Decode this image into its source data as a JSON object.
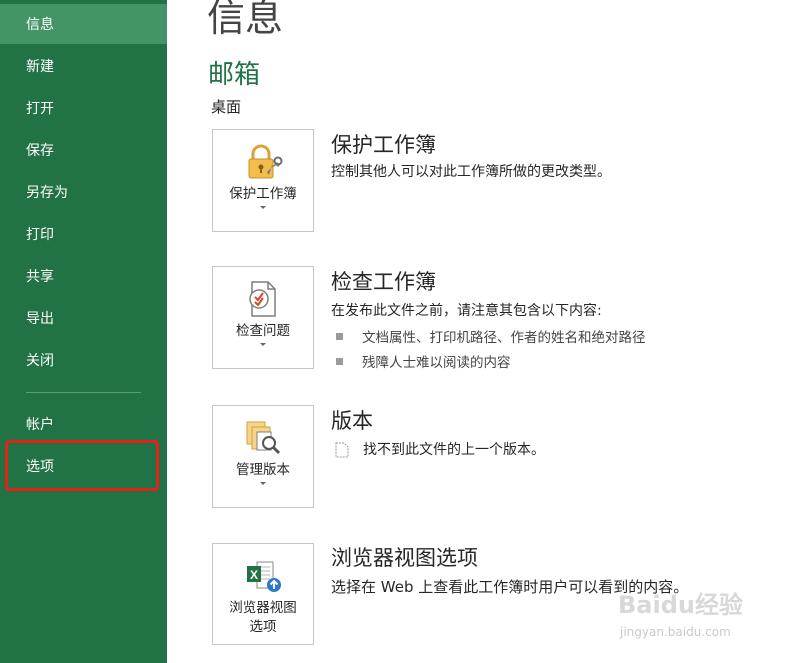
{
  "sidebar": {
    "items": [
      {
        "label": "信息",
        "active": true
      },
      {
        "label": "新建"
      },
      {
        "label": "打开"
      },
      {
        "label": "保存"
      },
      {
        "label": "另存为"
      },
      {
        "label": "打印"
      },
      {
        "label": "共享"
      },
      {
        "label": "导出"
      },
      {
        "label": "关闭"
      }
    ],
    "lower_items": [
      {
        "label": "帐户"
      },
      {
        "label": "选项"
      }
    ]
  },
  "main": {
    "title": "信息",
    "section": "邮箱",
    "location": "桌面",
    "protect": {
      "button": "保护工作簿",
      "heading": "保护工作簿",
      "desc": "控制其他人可以对此工作簿所做的更改类型。"
    },
    "inspect": {
      "button": "检查问题",
      "heading": "检查工作簿",
      "desc": "在发布此文件之前，请注意其包含以下内容:",
      "bullets": [
        "文档属性、打印机路径、作者的姓名和绝对路径",
        "残障人士难以阅读的内容"
      ]
    },
    "versions": {
      "button": "管理版本",
      "heading": "版本",
      "desc": "找不到此文件的上一个版本。"
    },
    "browser": {
      "button_line1": "浏览器视图",
      "button_line2": "选项",
      "heading": "浏览器视图选项",
      "desc": "选择在 Web 上查看此工作簿时用户可以看到的内容。"
    }
  },
  "watermark": {
    "text": "Baidu经验",
    "sub": "jingyan.baidu.com"
  },
  "colors": {
    "sidebar": "#217346",
    "active": "#439467",
    "accent": "#217346",
    "highlight": "#e0231b"
  }
}
